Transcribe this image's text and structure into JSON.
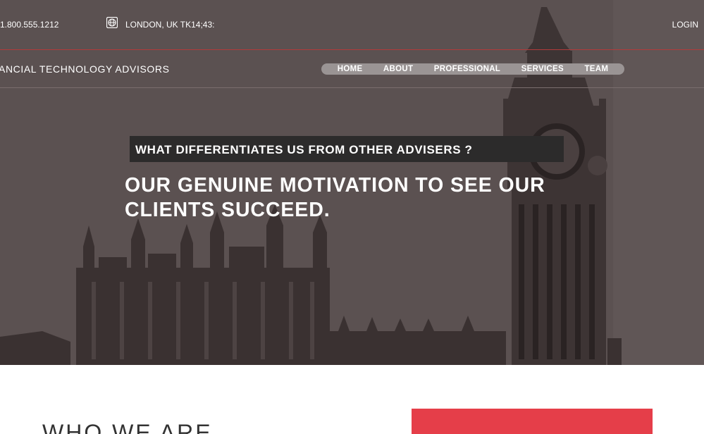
{
  "topbar": {
    "phone": "1.800.555.1212",
    "location": "LONDON, UK TK14;43:",
    "login_label": "LOGIN",
    "location_icon": "globe-icon"
  },
  "navbar": {
    "brand": "ANCIAL TECHNOLOGY ADVISORS",
    "items": [
      {
        "label": "HOME"
      },
      {
        "label": "ABOUT"
      },
      {
        "label": "PROFESSIONAL"
      },
      {
        "label": "SERVICES"
      },
      {
        "label": "TEAM"
      }
    ]
  },
  "hero": {
    "headline": "WHAT DIFFERENTIATES US FROM OTHER ADVISERS ?",
    "subheadline": "OUR GENUINE MOTIVATION TO SEE OUR CLIENTS SUCCEED.",
    "background_image": "london-big-ben-parliament-photo"
  },
  "section": {
    "title": "WHO WE ARE"
  },
  "colors": {
    "hero_overlay": "#5b5151",
    "topbar_divider": "#b23a3a",
    "menu_pill": "#9a9494",
    "headline_box": "#2c2b2b",
    "accent_red": "#e53e49",
    "text_white": "#ffffff"
  }
}
